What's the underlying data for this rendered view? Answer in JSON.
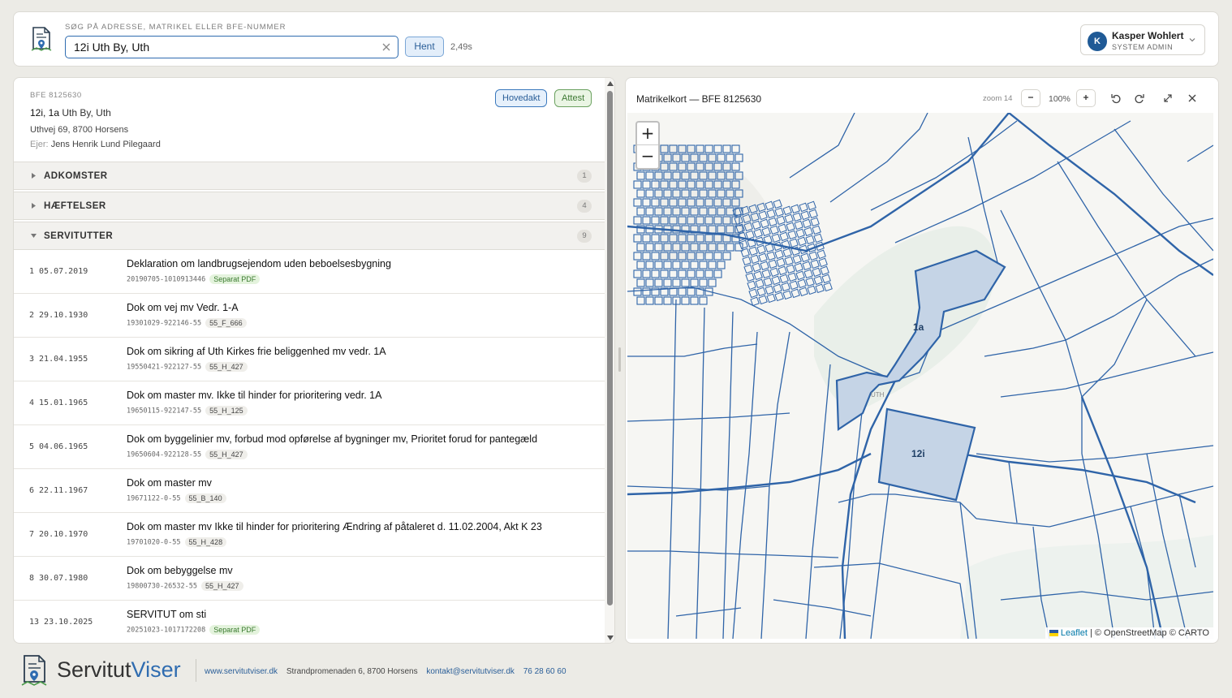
{
  "header": {
    "search_label": "SØG PÅ ADRESSE, MATRIKEL ELLER BFE-NUMMER",
    "search_value": "12i Uth By, Uth",
    "fetch_button": "Hent",
    "timing": "2,49s",
    "user": {
      "initial": "K",
      "name": "Kasper Wohlert",
      "role": "SYSTEM ADMIN"
    }
  },
  "property": {
    "bfe": "BFE 8125630",
    "matrikel_prefix": "12i, 1a",
    "matrikel_area": "Uth By, Uth",
    "address": "Uthvej 69, 8700 Horsens",
    "owner_label": "Ejer:",
    "owner_name": "Jens Henrik Lund Pilegaard",
    "badge_main": "Hovedakt",
    "badge_attest": "Attest"
  },
  "sections": [
    {
      "title": "ADKOMSTER",
      "count": "1",
      "expanded": false
    },
    {
      "title": "HÆFTELSER",
      "count": "4",
      "expanded": false
    },
    {
      "title": "SERVITUTTER",
      "count": "9",
      "expanded": true
    }
  ],
  "servitutter": [
    {
      "no": "1 05.07.2019",
      "title": "Deklaration om landbrugsejendom uden beboelsesbygning",
      "ref": "20190705-1010913446",
      "tag": "Separat PDF",
      "tag_type": "pdf"
    },
    {
      "no": "2 29.10.1930",
      "title": "Dok om vej mv Vedr. 1-A",
      "ref": "19301029-922146-55",
      "tag": "55_F_666",
      "tag_type": "ref"
    },
    {
      "no": "3 21.04.1955",
      "title": "Dok om sikring af Uth Kirkes frie beliggenhed mv vedr. 1A",
      "ref": "19550421-922127-55",
      "tag": "55_H_427",
      "tag_type": "ref"
    },
    {
      "no": "4 15.01.1965",
      "title": "Dok om master mv. Ikke til hinder for prioritering vedr. 1A",
      "ref": "19650115-922147-55",
      "tag": "55_H_125",
      "tag_type": "ref"
    },
    {
      "no": "5 04.06.1965",
      "title": "Dok om byggelinier mv, forbud mod opførelse af bygninger mv, Prioritet forud for pantegæld",
      "ref": "19650604-922128-55",
      "tag": "55_H_427",
      "tag_type": "ref"
    },
    {
      "no": "6 22.11.1967",
      "title": "Dok om master mv",
      "ref": "19671122-0-55",
      "tag": "55_B_140",
      "tag_type": "ref"
    },
    {
      "no": "7 20.10.1970",
      "title": "Dok om master mv Ikke til hinder for prioritering Ændring af påtaleret d. 11.02.2004, Akt K 23",
      "ref": "19701020-0-55",
      "tag": "55_H_428",
      "tag_type": "ref"
    },
    {
      "no": "8 30.07.1980",
      "title": "Dok om bebyggelse mv",
      "ref": "19800730-26532-55",
      "tag": "55_H_427",
      "tag_type": "ref"
    },
    {
      "no": "13 23.10.2025",
      "title": "SERVITUT om sti",
      "ref": "20251023-1017172208",
      "tag": "Separat PDF",
      "tag_type": "pdf"
    }
  ],
  "map": {
    "title": "Matrikelkort — BFE 8125630",
    "zoom_label": "zoom 14",
    "zoom_percent": "100%",
    "zoom_in": "+",
    "zoom_out": "−",
    "parcel_labels": [
      "1a",
      "12i"
    ],
    "place_label": "UTH",
    "attribution_leaflet": "Leaflet",
    "attribution_rest": "| © OpenStreetMap © CARTO",
    "colors": {
      "parcel_line": "#2f64a8",
      "highlight_fill": "#c5d4e6",
      "land": "#f6f6f3"
    }
  },
  "footer": {
    "brand_a": "Servitut",
    "brand_b": "Viser",
    "website": "www.servitutviser.dk",
    "address": "Strandpromenaden 6, 8700 Horsens",
    "email": "kontakt@servitutviser.dk",
    "phone": "76 28 60 60"
  }
}
